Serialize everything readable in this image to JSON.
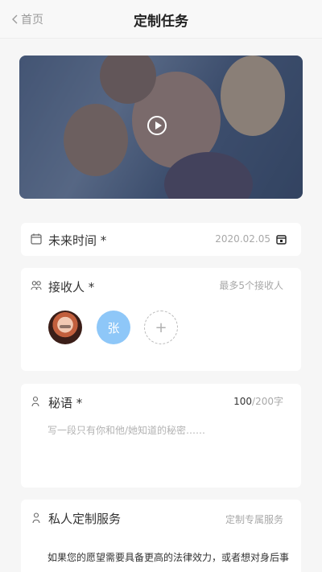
{
  "header": {
    "back_label": "首页",
    "title": "定制任务"
  },
  "banner": {
    "play_icon": "play-icon"
  },
  "future_time": {
    "icon": "calendar-icon",
    "label": "未来时间 *",
    "value": "2020.02.05",
    "picker_icon": "calendar-picker-icon"
  },
  "recipients": {
    "icon": "people-icon",
    "label": "接收人 *",
    "hint": "最多5个接收人",
    "avatar_letter": "张",
    "add_label": "+"
  },
  "secret": {
    "icon": "person-icon",
    "label": "秘语 *",
    "count": "100",
    "max": "/200字",
    "placeholder": "写一段只有你和他/她知道的秘密……"
  },
  "private_service": {
    "icon": "person-icon",
    "label": "私人定制服务",
    "link": "定制专属服务",
    "desc": "如果您的愿望需要具备更高的法律效力，或者想对身后事"
  }
}
